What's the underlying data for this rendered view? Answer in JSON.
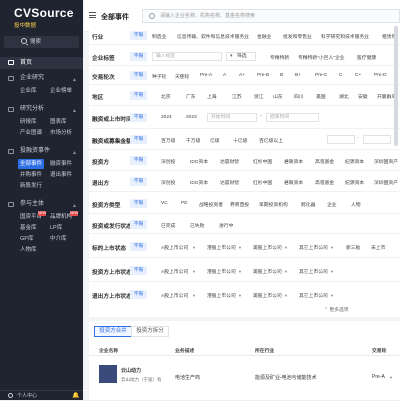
{
  "sidebar": {
    "logo": "CVSource",
    "logo_sub": "投中数据",
    "search_placeholder": "搜索",
    "home": "首页",
    "sections": [
      {
        "label": "企业研究",
        "items": [
          "企业库",
          "企业榜单"
        ]
      },
      {
        "label": "研究分析",
        "items": [
          "研报库",
          "图表库",
          "产业图谱",
          "市场分析"
        ]
      },
      {
        "label": "投融资事件",
        "items": [
          "全部事件",
          "融资事件",
          "并购事件",
          "退出事件",
          "新股发行"
        ]
      },
      {
        "label": "参与主体",
        "items": [
          "国资平台",
          "品牌机构",
          "LP库",
          "基金库",
          "GP库",
          "中介库",
          "人物库"
        ]
      }
    ],
    "new_badge": "NEW",
    "bottom_user": "个人中心"
  },
  "header": {
    "title": "全部事件",
    "search_placeholder": "请输入企业名称、机构名称、基金名称搜索"
  },
  "filters": {
    "unlimited": "不限",
    "industry": {
      "label": "行业",
      "options": [
        "制造业",
        "信息传输、软件和信息技术服务业",
        "金融业",
        "批发和零售业",
        "科学研究和技术服务业",
        "租赁和"
      ]
    },
    "company_tag": {
      "label": "企业标签",
      "input_placeholder": "输入标签",
      "filter_btn": "筛选",
      "options": [
        "专精特新",
        "专精特新\"小巨人\"企业",
        "医疗健康"
      ]
    },
    "round": {
      "label": "交易轮次",
      "options": [
        "种子轮",
        "天使轮",
        "Pre-A",
        "A",
        "A+",
        "Pre-B",
        "B",
        "B+",
        "Pre-C",
        "C",
        "C+",
        "Pre-D"
      ]
    },
    "region": {
      "label": "地区",
      "options": [
        "北京",
        "广东",
        "上海",
        "江苏",
        "浙江",
        "山东",
        "四川",
        "美国",
        "湖北",
        "安徽",
        "开曼群岛"
      ]
    },
    "date": {
      "label": "融资或上市时间",
      "options": [
        "2024",
        "2023"
      ],
      "start_placeholder": "开始时间",
      "end_placeholder": "结束时间",
      "separator": "-"
    },
    "amount": {
      "label": "融资或募集金额",
      "options": [
        "百万级",
        "千万级",
        "亿级",
        "十亿级",
        "百亿级以上"
      ],
      "separator": "-"
    },
    "investor": {
      "label": "投资方",
      "options": [
        "深创投",
        "IDG资本",
        "达晨财智",
        "红杉中国",
        "君联资本",
        "高瓴基金",
        "纪源资本",
        "深圳国资产"
      ]
    },
    "exit_party": {
      "label": "退出方",
      "options": [
        "深创投",
        "IDG资本",
        "达晨财智",
        "红杉中国",
        "君联资本",
        "高瓴基金",
        "纪源资本",
        "深圳国资产"
      ]
    },
    "investor_type": {
      "label": "投资方类型",
      "options": [
        "VC",
        "PE",
        "战略投资者",
        "券商直投",
        "早期投资机构",
        "孵化器",
        "企业",
        "人物"
      ]
    },
    "issue_status": {
      "label": "投资或发行状态",
      "options": [
        "已完成",
        "已失败",
        "进行中"
      ]
    },
    "target_status": {
      "label": "标的上市状态",
      "options": [
        "A股上市公司",
        "港股上市公司",
        "美股上市公司",
        "其它上市公司",
        "新三板",
        "未上市"
      ]
    },
    "investor_status": {
      "label": "投资方上市状态",
      "options": [
        "A股上市公司",
        "港股上市公司",
        "美股上市公司",
        "其它上市公司"
      ]
    },
    "exit_status": {
      "label": "退出方上市状态",
      "options": [
        "A股上市公司",
        "港股上市公司",
        "美股上市公司",
        "其它上市公司"
      ]
    },
    "more_label": "更多选项"
  },
  "tabs": [
    "投资方合并",
    "投资方拆分"
  ],
  "table": {
    "headers": [
      "企业名称",
      "业务描述",
      "所在行业",
      "交易轮"
    ],
    "rows": [
      {
        "name": "云山动力",
        "full_name": "云山动力（宁波）有",
        "desc": "电池生产商",
        "industry": "能源及矿业-电池与储能技术",
        "round": "Pre-A"
      }
    ]
  }
}
